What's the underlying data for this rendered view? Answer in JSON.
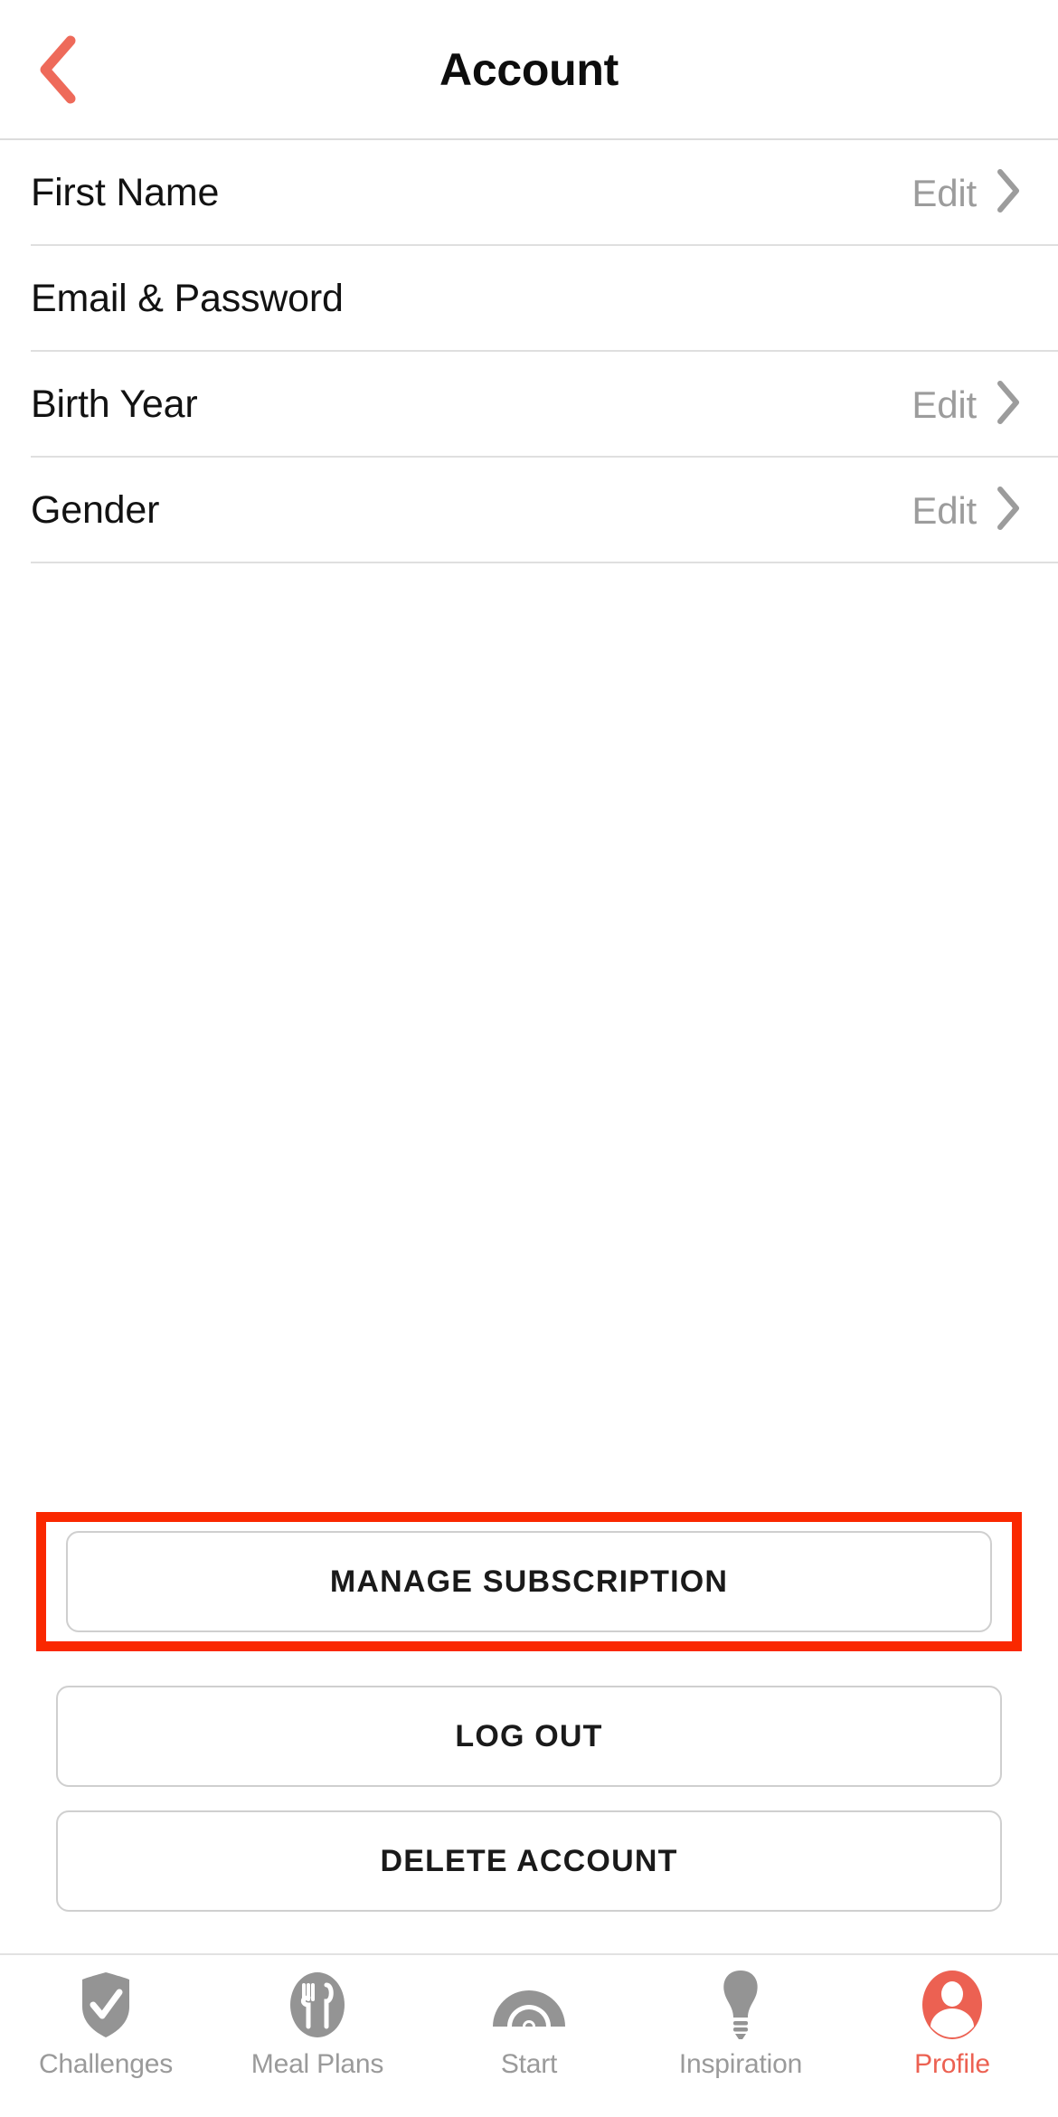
{
  "header": {
    "title": "Account",
    "back_icon": "chevron-left-icon",
    "back_color": "#ee6a5a"
  },
  "account_rows": [
    {
      "label": "First Name",
      "action": "Edit",
      "has_action": true,
      "chevron": "chevron-right-icon"
    },
    {
      "label": "Email & Password",
      "action": "",
      "has_action": false,
      "chevron": ""
    },
    {
      "label": "Birth Year",
      "action": "Edit",
      "has_action": true,
      "chevron": "chevron-right-icon"
    },
    {
      "label": "Gender",
      "action": "Edit",
      "has_action": true,
      "chevron": "chevron-right-icon"
    }
  ],
  "actions": {
    "manage_subscription": "MANAGE SUBSCRIPTION",
    "log_out": "LOG OUT",
    "delete_account": "DELETE ACCOUNT",
    "highlight_color": "#fa2800"
  },
  "tabbar": {
    "active_color": "#ec6152",
    "inactive_color": "#949494",
    "items": [
      {
        "label": "Challenges",
        "icon": "shield-check-icon",
        "active": false
      },
      {
        "label": "Meal Plans",
        "icon": "fork-knife-icon",
        "active": false
      },
      {
        "label": "Start",
        "icon": "arches-icon",
        "active": false
      },
      {
        "label": "Inspiration",
        "icon": "lightbulb-icon",
        "active": false
      },
      {
        "label": "Profile",
        "icon": "person-circle-icon",
        "active": true
      }
    ]
  }
}
